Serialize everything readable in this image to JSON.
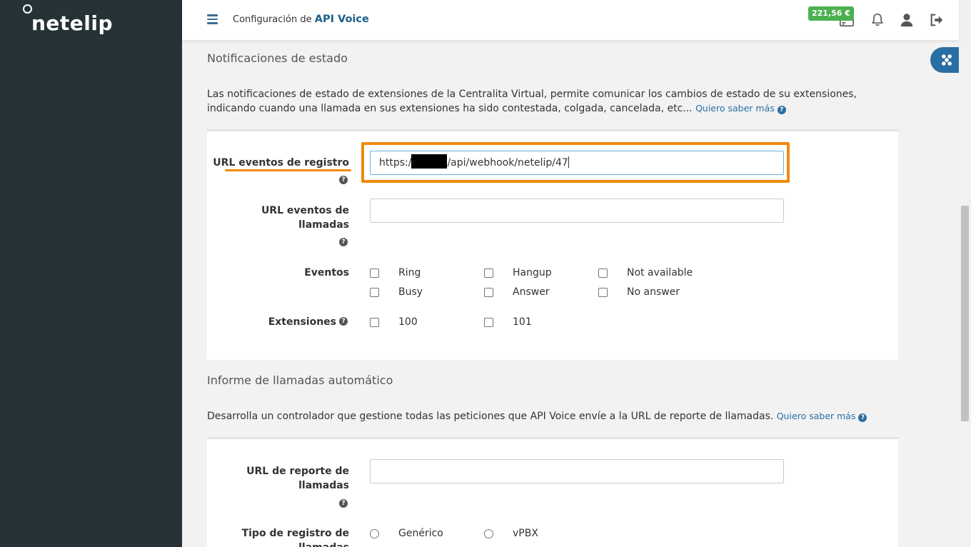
{
  "brand": {
    "logo_text": "netelip"
  },
  "header": {
    "title_prefix": "Configuración de",
    "title_accent": "API Voice",
    "balance": "221,56 €"
  },
  "colors": {
    "accent": "#1d5f8a",
    "link": "#2a6fa3",
    "highlight": "#f08a0c",
    "sidebar": "#253236",
    "balance": "#4caf50"
  },
  "status_section": {
    "title": "Notificaciones de estado",
    "description": "Las notificaciones de estado de extensiones de la Centralita Virtual, permite comunicar los cambios de estado de su extensiones, indicando cuando una llamada en sus extensiones ha sido contestada, colgada, cancelada, etc...",
    "learn_more": "Quiero saber más",
    "fields": {
      "register_url_label": "URL eventos de registro",
      "register_url_value_prefix": "https:/",
      "register_url_value_suffix": "/api/webhook/netelip/47",
      "calls_url_label_1": "URL eventos de",
      "calls_url_label_2": "llamadas",
      "calls_url_value": "",
      "events_label": "Eventos",
      "events": [
        "Ring",
        "Hangup",
        "Not available",
        "Busy",
        "Answer",
        "No answer"
      ],
      "extensions_label": "Extensiones",
      "extensions": [
        "100",
        "101"
      ]
    }
  },
  "report_section": {
    "title": "Informe de llamadas automático",
    "description": "Desarrolla un controlador que gestione todas las peticiones que API Voice envíe a la URL de reporte de llamadas.",
    "learn_more": "Quiero saber más",
    "fields": {
      "report_url_label_1": "URL de reporte de",
      "report_url_label_2": "llamadas",
      "report_url_value": "",
      "log_type_label_1": "Tipo de registro de",
      "log_type_label_2": "llamadas",
      "log_types": [
        "Genérico",
        "vPBX"
      ]
    }
  }
}
